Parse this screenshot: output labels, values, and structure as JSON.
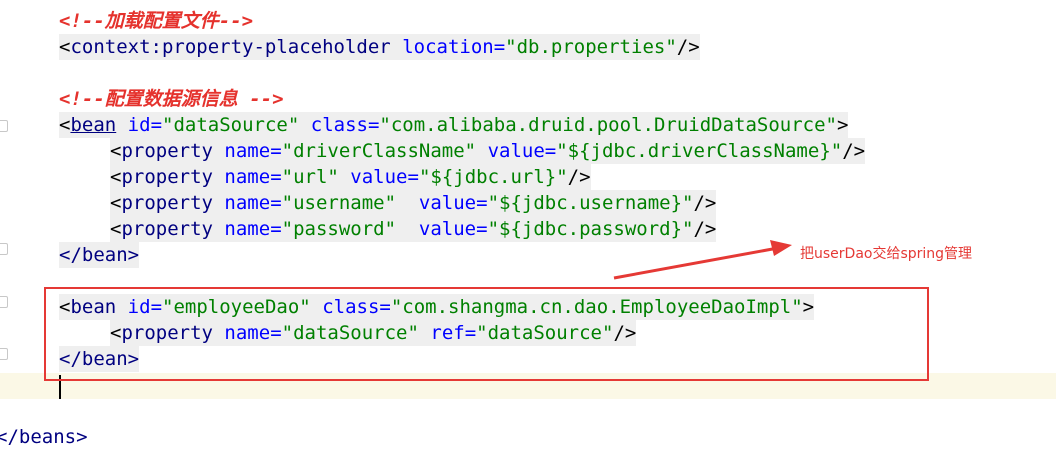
{
  "editor": {
    "comment_load": "<!--加载配置文件-->",
    "placeholder": {
      "open": "<",
      "tag": "context:property-placeholder",
      "attr": "location",
      "eq": "=",
      "val": "\"db.properties\"",
      "close": "/>"
    },
    "comment_ds": "<!--配置数据源信息 -->",
    "bean1": {
      "lt": "<",
      "tag": "bean",
      "id_attr": "id",
      "id_val": "\"dataSource\"",
      "class_attr": "class",
      "class_val": "\"com.alibaba.druid.pool.DruidDataSource\"",
      "gt": ">",
      "end": "</bean>"
    },
    "properties": [
      {
        "attr": "name",
        "name": "\"driverClassName\"",
        "vattr": "value",
        "value": "\"${jdbc.driverClassName}\""
      },
      {
        "attr": "name",
        "name": "\"url\"",
        "vattr": "value",
        "value": "\"${jdbc.url}\""
      },
      {
        "attr": "name",
        "name": "\"username\"",
        "vattr": "value",
        "value": "\"${jdbc.username}\""
      },
      {
        "attr": "name",
        "name": "\"password\"",
        "vattr": "value",
        "value": "\"${jdbc.password}\""
      }
    ],
    "prop_open": "<",
    "prop_tag": "property",
    "prop_close": "/>",
    "eq": "=",
    "bean2": {
      "lt": "<",
      "tag": "bean",
      "id_attr": "id",
      "id_val": "\"employeeDao\"",
      "class_attr": "class",
      "class_val": "\"com.shangma.cn.dao.EmployeeDaoImpl\"",
      "gt": ">",
      "prop_name_attr": "name",
      "prop_name_val": "\"dataSource\"",
      "prop_ref_attr": "ref",
      "prop_ref_val": "\"dataSource\"",
      "end": "</bean>"
    },
    "beans_end": "</beans>"
  },
  "annotation": {
    "text": "把userDao交给spring管理",
    "color": "#e53935"
  }
}
